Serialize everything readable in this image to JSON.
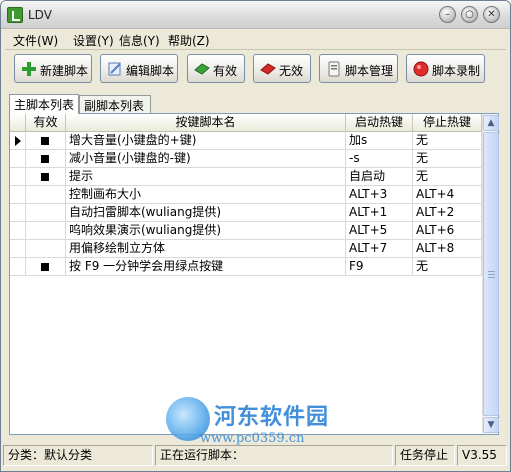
{
  "window": {
    "title": "LDV"
  },
  "menu": [
    {
      "label": "文件(W)"
    },
    {
      "label": "设置(Y)"
    },
    {
      "label": "信息(Y)"
    },
    {
      "label": "帮助(Z)"
    }
  ],
  "toolbar": [
    {
      "label": "新建脚本",
      "icon": "plus-icon",
      "color": "#2f9e2f"
    },
    {
      "label": "编辑脚本",
      "icon": "edit-icon",
      "color": "#5a7fc4"
    },
    {
      "label": "有效",
      "icon": "enable-icon",
      "color": "#39a339"
    },
    {
      "label": "无效",
      "icon": "disable-icon",
      "color": "#d12a2a"
    },
    {
      "label": "脚本管理",
      "icon": "script-manage-icon",
      "color": "#8a8a8a"
    },
    {
      "label": "脚本录制",
      "icon": "record-icon",
      "color": "#e02b2b"
    }
  ],
  "tabs": [
    {
      "label": "主脚本列表",
      "active": true
    },
    {
      "label": "副脚本列表",
      "active": false
    }
  ],
  "table": {
    "columns": [
      "有效",
      "按键脚本名",
      "启动热键",
      "停止热键"
    ],
    "rows": [
      {
        "current": true,
        "enabled": true,
        "name": "增大音量(小键盘的+键)",
        "start": "加s",
        "stop": "无"
      },
      {
        "current": false,
        "enabled": true,
        "name": "减小音量(小键盘的-键)",
        "start": "-s",
        "stop": "无"
      },
      {
        "current": false,
        "enabled": true,
        "name": "提示",
        "start": "自启动",
        "stop": "无"
      },
      {
        "current": false,
        "enabled": false,
        "name": "控制画布大小",
        "start": "ALT+3",
        "stop": "ALT+4"
      },
      {
        "current": false,
        "enabled": false,
        "name": "自动扫雷脚本(wuliang提供)",
        "start": "ALT+1",
        "stop": "ALT+2"
      },
      {
        "current": false,
        "enabled": false,
        "name": "呜响效果演示(wuliang提供)",
        "start": "ALT+5",
        "stop": "ALT+6"
      },
      {
        "current": false,
        "enabled": false,
        "name": "用偏移绘制立方体",
        "start": "ALT+7",
        "stop": "ALT+8"
      },
      {
        "current": false,
        "enabled": true,
        "name": "按 F9 一分钟学会用绿点按键",
        "start": "F9",
        "stop": "无"
      }
    ]
  },
  "status": {
    "category": "分类：默认分类",
    "running": "正在运行脚本：",
    "task": "任务停止",
    "version": "V3.55"
  },
  "watermark": {
    "name": "河东软件园",
    "url": "www.pc0359.cn"
  }
}
